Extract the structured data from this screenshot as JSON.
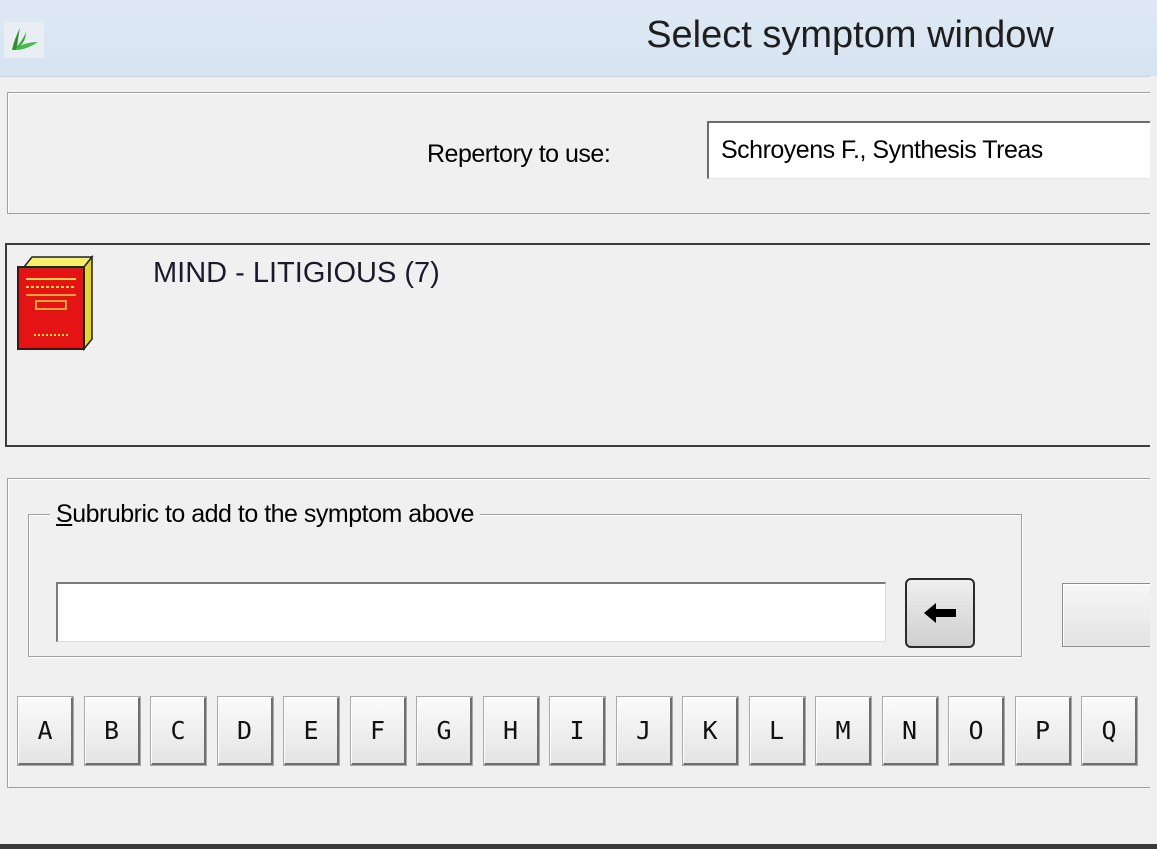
{
  "window": {
    "title": "Select symptom window"
  },
  "repertory": {
    "label": "Repertory to use:",
    "selected_value": "Schroyens F., Synthesis Treas"
  },
  "symptom": {
    "text": "MIND - LITIGIOUS (7)",
    "icon": "book-icon"
  },
  "subrubric": {
    "legend_accel": "S",
    "legend_rest": "ubrubric to add to the symptom above",
    "input_value": "",
    "arrow_icon": "arrow-left-icon"
  },
  "letters": [
    "A",
    "B",
    "C",
    "D",
    "E",
    "F",
    "G",
    "H",
    "I",
    "J",
    "K",
    "L",
    "M",
    "N",
    "O",
    "P",
    "Q"
  ],
  "colors": {
    "titlebar": "#dfe9f5",
    "window_bg": "#f0f0f0",
    "book_red": "#e01010",
    "book_yellow": "#f3e02b",
    "leaf_green": "#3aa63a"
  }
}
